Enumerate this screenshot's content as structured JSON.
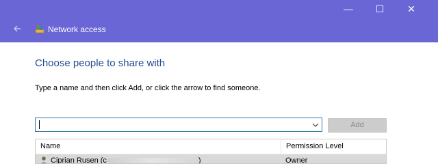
{
  "window": {
    "title": "Network access",
    "controls": {
      "minimize": "—",
      "maximize": "☐",
      "close": "✕"
    }
  },
  "dialog": {
    "heading": "Choose people to share with",
    "instructions": "Type a name and then click Add, or click the arrow to find someone.",
    "input": {
      "value": "",
      "placeholder": ""
    },
    "add_label": "Add"
  },
  "table": {
    "columns": [
      "Name",
      "Permission Level"
    ],
    "rows": [
      {
        "name_start": "Ciprian Rusen (c",
        "name_end": ")",
        "permission": "Owner"
      }
    ]
  },
  "colors": {
    "titlebar": "#6b66d6",
    "heading": "#1e4e8c",
    "input_border": "#2b7aa0",
    "selected_row": "#d9d9d9"
  },
  "icons": [
    "back-arrow-icon",
    "network-app-icon",
    "chevron-down-icon",
    "user-icon"
  ]
}
